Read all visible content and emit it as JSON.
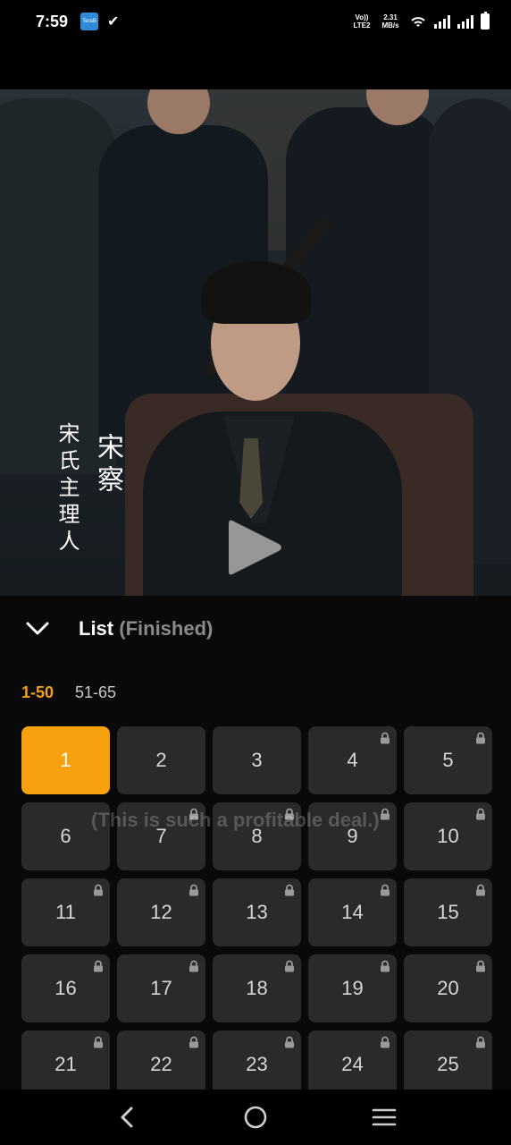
{
  "status_bar": {
    "time": "7:59",
    "app_icon_label": "TeraB",
    "network_label": "Vo)) LTE2",
    "speed": "2.31 MB/s"
  },
  "video": {
    "caption_right": "宋察",
    "caption_left": "宋氏主理人",
    "subtitle_watermark": "(This is such a profitable deal.)",
    "icons": [
      "play-icon"
    ]
  },
  "panel": {
    "title": "List",
    "subtitle": "(Finished)",
    "ranges": [
      {
        "label": "1-50",
        "active": true
      },
      {
        "label": "51-65",
        "active": false
      }
    ],
    "episodes": [
      {
        "n": "1",
        "locked": false,
        "active": true
      },
      {
        "n": "2",
        "locked": false,
        "active": false
      },
      {
        "n": "3",
        "locked": false,
        "active": false
      },
      {
        "n": "4",
        "locked": true,
        "active": false
      },
      {
        "n": "5",
        "locked": true,
        "active": false
      },
      {
        "n": "6",
        "locked": false,
        "active": false
      },
      {
        "n": "7",
        "locked": true,
        "active": false
      },
      {
        "n": "8",
        "locked": true,
        "active": false
      },
      {
        "n": "9",
        "locked": true,
        "active": false
      },
      {
        "n": "10",
        "locked": true,
        "active": false
      },
      {
        "n": "11",
        "locked": true,
        "active": false
      },
      {
        "n": "12",
        "locked": true,
        "active": false
      },
      {
        "n": "13",
        "locked": true,
        "active": false
      },
      {
        "n": "14",
        "locked": true,
        "active": false
      },
      {
        "n": "15",
        "locked": true,
        "active": false
      },
      {
        "n": "16",
        "locked": true,
        "active": false
      },
      {
        "n": "17",
        "locked": true,
        "active": false
      },
      {
        "n": "18",
        "locked": true,
        "active": false
      },
      {
        "n": "19",
        "locked": true,
        "active": false
      },
      {
        "n": "20",
        "locked": true,
        "active": false
      },
      {
        "n": "21",
        "locked": true,
        "active": false
      },
      {
        "n": "22",
        "locked": true,
        "active": false
      },
      {
        "n": "23",
        "locked": true,
        "active": false
      },
      {
        "n": "24",
        "locked": true,
        "active": false
      },
      {
        "n": "25",
        "locked": true,
        "active": false
      }
    ],
    "accent_color": "#f8a10f"
  },
  "navbar": {
    "icons": [
      "back-icon",
      "home-icon",
      "menu-icon"
    ]
  }
}
